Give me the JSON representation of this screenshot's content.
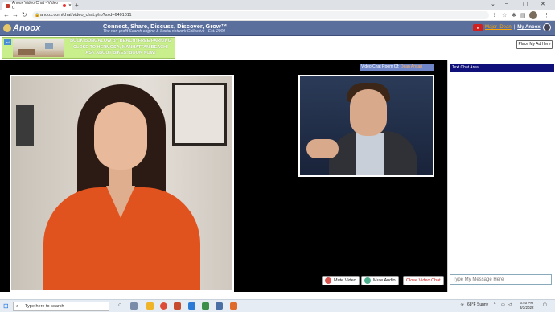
{
  "browser": {
    "tab_title": "Anoox Video Chat - Video C",
    "url": "anoox.com/chat/video_chat.php?sxd=6401011"
  },
  "header": {
    "logo_text": "Anoox",
    "tagline": "Connect, Share, Discuss, Discover, Grow™",
    "subtagline": "The non-profit Search engine & Social network Collective ·  Est. 2009",
    "username": "Major_Dean",
    "separator": "|",
    "my_anoox": "My Anoox"
  },
  "ad": {
    "info_badge": "ad",
    "text_line1": "BOOK BUNGALOW BY BEACH! FREE PARKING",
    "text_line2": "CLOSE TO HERMOSA, MANHATTAN  BEACH!",
    "text_line3": "ASK ABOUT BIKES!  BOOK NOW!",
    "place_ad_label": "Place My Ad Here"
  },
  "room": {
    "label_prefix": "Video Chat Room Of:",
    "owner": "Dean Ansari"
  },
  "controls": {
    "mute_video": "Mute Video",
    "mute_audio": "Mute Audio",
    "close_video_chat": "Close Video Chat"
  },
  "chat": {
    "header": "Text Chat Area",
    "input_placeholder": "Type My Message Here"
  },
  "taskbar": {
    "search_placeholder": "Type here to search",
    "weather": "68°F  Sunny",
    "time": "3:40 PM",
    "date": "3/3/2022"
  },
  "colors": {
    "header_bg": "#5a6f9c",
    "ad_bg": "#c8ef8c",
    "chat_header_bg": "#10107a",
    "room_label_bg": "#6f87c9",
    "close_text": "#d02020"
  }
}
